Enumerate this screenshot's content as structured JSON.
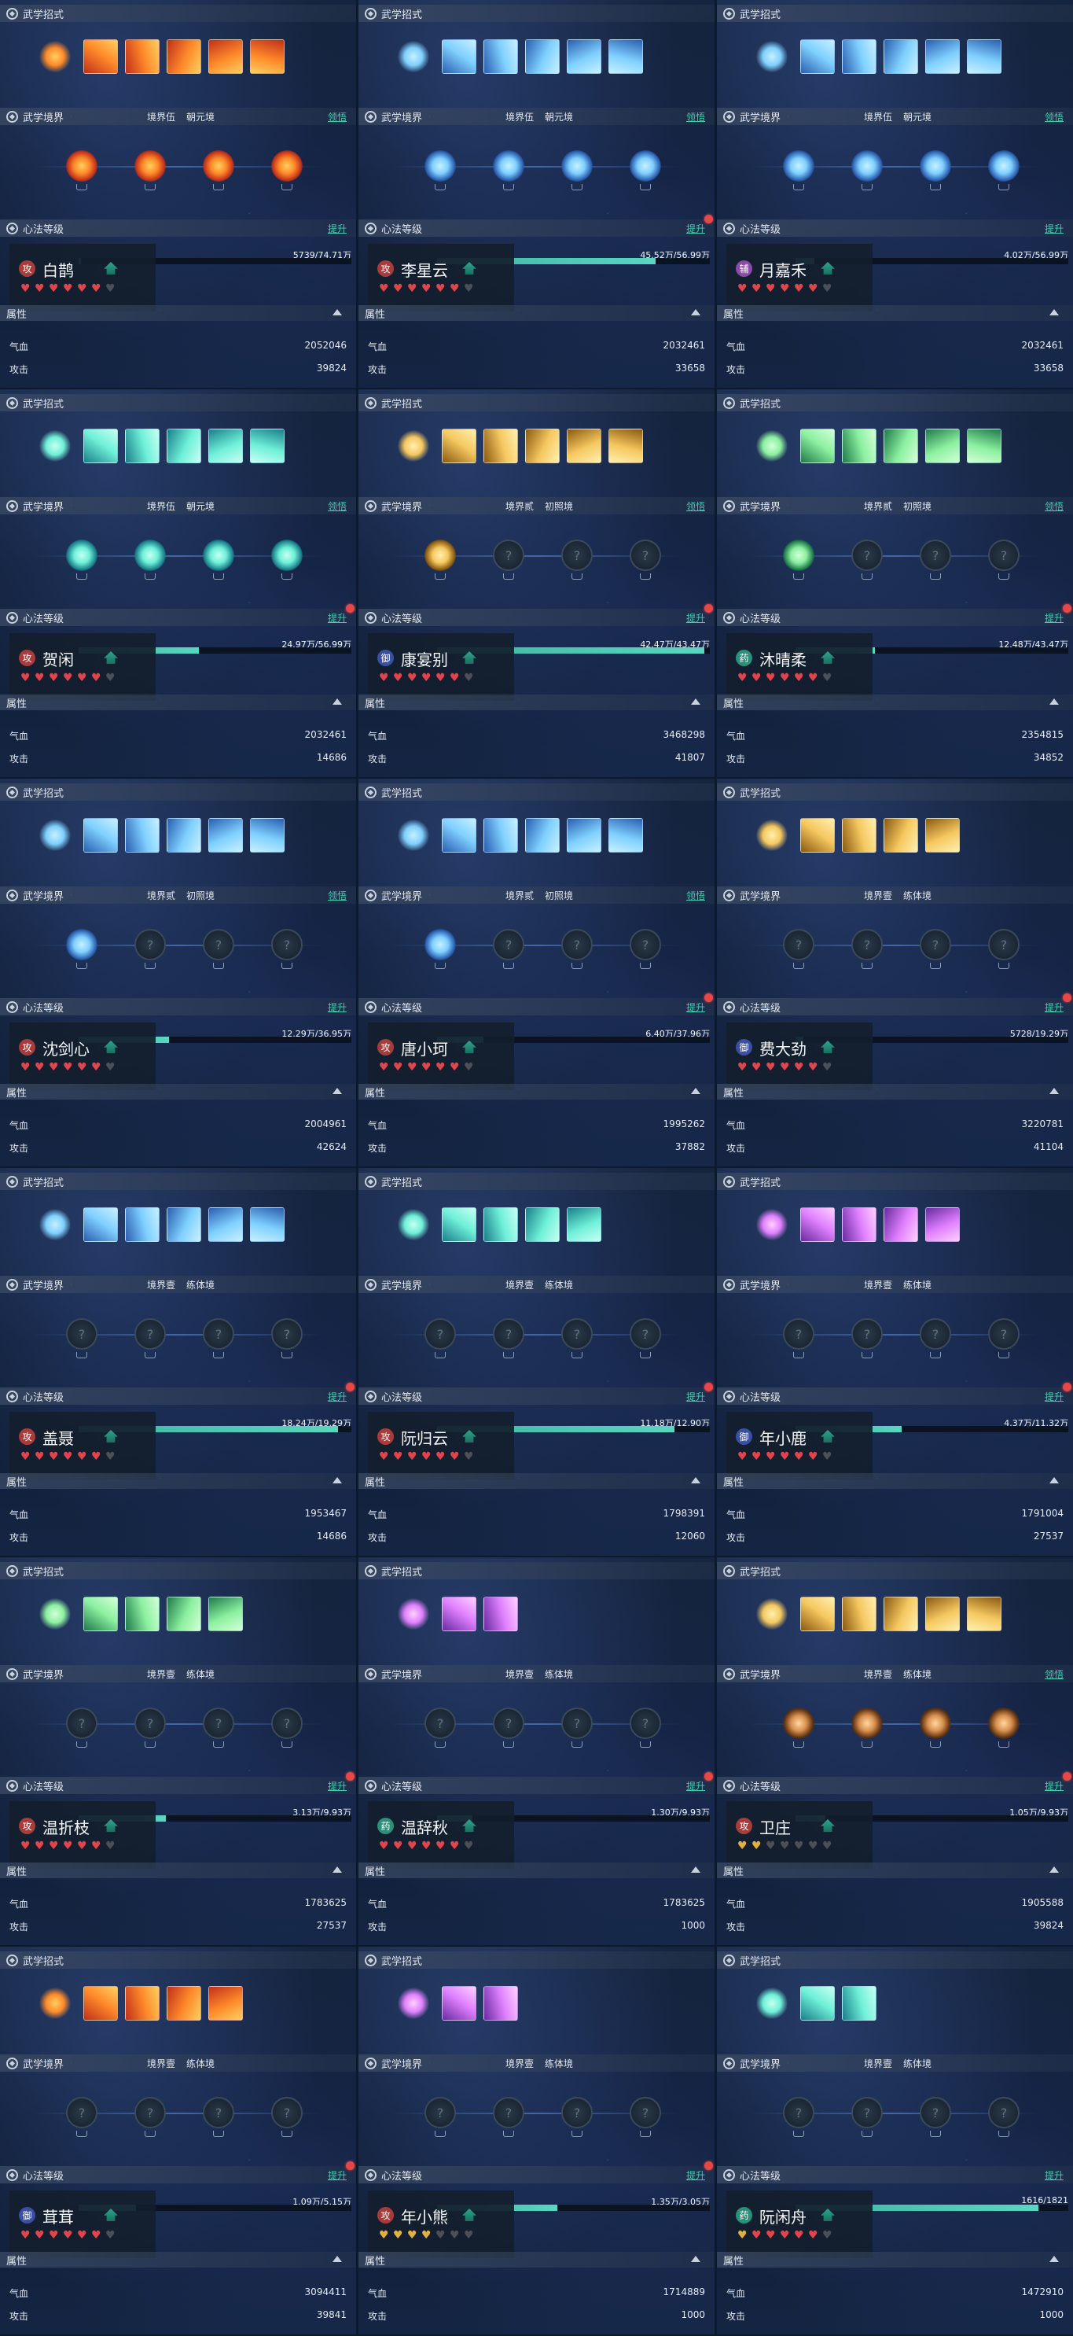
{
  "labels": {
    "skills": "武学招式",
    "realm": "武学境界",
    "heart": "心法等级",
    "attr": "属性",
    "lingwu": "领悟",
    "upgrade": "提升",
    "hp": "气血",
    "atk": "攻击"
  },
  "cards": [
    {
      "name": "白鹊",
      "role": "攻",
      "role_type": "atk",
      "realm_stage": "境界伍",
      "realm_grade": "朝元境",
      "show_lingwu": true,
      "show_dot": false,
      "progress_text": "5739/74.71万",
      "progress": 0.008,
      "hp": "2052046",
      "atk": "39824",
      "hearts": "rrrrrrd",
      "skill_count": 5,
      "skill_hue": "fire",
      "nodes_lit": 4,
      "node_hue": "fire"
    },
    {
      "name": "李星云",
      "role": "攻",
      "role_type": "atk",
      "realm_stage": "境界伍",
      "realm_grade": "朝元境",
      "show_lingwu": true,
      "show_dot": true,
      "progress_text": "45.52万/56.99万",
      "progress": 0.8,
      "hp": "2032461",
      "atk": "33658",
      "hearts": "rrrrrrd",
      "skill_count": 5,
      "skill_hue": "ice",
      "nodes_lit": 4,
      "node_hue": "ice"
    },
    {
      "name": "月嘉禾",
      "role": "辅",
      "role_type": "sup2",
      "realm_stage": "境界伍",
      "realm_grade": "朝元境",
      "show_lingwu": true,
      "show_dot": false,
      "progress_text": "4.02万/56.99万",
      "progress": 0.07,
      "hp": "2032461",
      "atk": "33658",
      "hearts": "rrrrrrd",
      "skill_count": 5,
      "skill_hue": "ice",
      "nodes_lit": 4,
      "node_hue": "ice"
    },
    {
      "name": "贺闲",
      "role": "攻",
      "role_type": "atk",
      "realm_stage": "境界伍",
      "realm_grade": "朝元境",
      "show_lingwu": true,
      "show_dot": true,
      "progress_text": "24.97万/56.99万",
      "progress": 0.44,
      "hp": "2032461",
      "atk": "14686",
      "hearts": "rrrrrrd",
      "skill_count": 5,
      "skill_hue": "teal",
      "nodes_lit": 4,
      "node_hue": "teal"
    },
    {
      "name": "康宴别",
      "role": "御",
      "role_type": "def",
      "realm_stage": "境界贰",
      "realm_grade": "初照境",
      "show_lingwu": true,
      "show_dot": true,
      "progress_text": "42.47万/43.47万",
      "progress": 0.98,
      "hp": "3468298",
      "atk": "41807",
      "hearts": "rrrrrrd",
      "skill_count": 5,
      "skill_hue": "gold",
      "nodes_lit": 1,
      "node_hue": "gold"
    },
    {
      "name": "沐晴柔",
      "role": "药",
      "role_type": "sup",
      "realm_stage": "境界贰",
      "realm_grade": "初照境",
      "show_lingwu": true,
      "show_dot": true,
      "progress_text": "12.48万/43.47万",
      "progress": 0.29,
      "hp": "2354815",
      "atk": "34852",
      "hearts": "rrrrrrd",
      "skill_count": 5,
      "skill_hue": "green",
      "nodes_lit": 1,
      "node_hue": "green"
    },
    {
      "name": "沈剑心",
      "role": "攻",
      "role_type": "atk",
      "realm_stage": "境界贰",
      "realm_grade": "初照境",
      "show_lingwu": true,
      "show_dot": false,
      "progress_text": "12.29万/36.95万",
      "progress": 0.33,
      "hp": "2004961",
      "atk": "42624",
      "hearts": "rrrrrrd",
      "skill_count": 5,
      "skill_hue": "ice",
      "nodes_lit": 1,
      "node_hue": "ice"
    },
    {
      "name": "唐小珂",
      "role": "攻",
      "role_type": "atk",
      "realm_stage": "境界贰",
      "realm_grade": "初照境",
      "show_lingwu": true,
      "show_dot": true,
      "progress_text": "6.40万/37.96万",
      "progress": 0.17,
      "hp": "1995262",
      "atk": "37882",
      "hearts": "rrrrrrd",
      "skill_count": 5,
      "skill_hue": "ice",
      "nodes_lit": 1,
      "node_hue": "ice"
    },
    {
      "name": "费大劲",
      "role": "御",
      "role_type": "def",
      "realm_stage": "境界壹",
      "realm_grade": "练体境",
      "show_lingwu": false,
      "show_dot": true,
      "progress_text": "5728/19.29万",
      "progress": 0.03,
      "hp": "3220781",
      "atk": "41104",
      "hearts": "rrrrrrd",
      "skill_count": 4,
      "skill_hue": "gold",
      "nodes_lit": 0,
      "node_hue": "gold"
    },
    {
      "name": "盖聂",
      "role": "攻",
      "role_type": "atk",
      "realm_stage": "境界壹",
      "realm_grade": "练体境",
      "show_lingwu": false,
      "show_dot": true,
      "progress_text": "18.24万/19.29万",
      "progress": 0.95,
      "hp": "1953467",
      "atk": "14686",
      "hearts": "rrrrrrd",
      "skill_count": 5,
      "skill_hue": "ice",
      "nodes_lit": 0,
      "node_hue": "ice"
    },
    {
      "name": "阮归云",
      "role": "攻",
      "role_type": "atk",
      "realm_stage": "境界壹",
      "realm_grade": "练体境",
      "show_lingwu": false,
      "show_dot": true,
      "progress_text": "11.18万/12.90万",
      "progress": 0.87,
      "hp": "1798391",
      "atk": "12060",
      "hearts": "rrrrrrd",
      "skill_count": 4,
      "skill_hue": "teal",
      "nodes_lit": 0,
      "node_hue": "teal"
    },
    {
      "name": "年小鹿",
      "role": "御",
      "role_type": "def",
      "realm_stage": "境界壹",
      "realm_grade": "练体境",
      "show_lingwu": false,
      "show_dot": true,
      "progress_text": "4.37万/11.32万",
      "progress": 0.39,
      "hp": "1791004",
      "atk": "27537",
      "hearts": "rrrrrrd",
      "skill_count": 4,
      "skill_hue": "purple",
      "nodes_lit": 0,
      "node_hue": "purple"
    },
    {
      "name": "温折枝",
      "role": "攻",
      "role_type": "atk",
      "realm_stage": "境界壹",
      "realm_grade": "练体境",
      "show_lingwu": false,
      "show_dot": true,
      "progress_text": "3.13万/9.93万",
      "progress": 0.32,
      "hp": "1783625",
      "atk": "27537",
      "hearts": "rrrrrrd",
      "skill_count": 4,
      "skill_hue": "green",
      "nodes_lit": 0,
      "node_hue": "green"
    },
    {
      "name": "温辞秋",
      "role": "药",
      "role_type": "sup",
      "realm_stage": "境界壹",
      "realm_grade": "练体境",
      "show_lingwu": false,
      "show_dot": true,
      "progress_text": "1.30万/9.93万",
      "progress": 0.13,
      "hp": "1783625",
      "atk": "1000",
      "hearts": "rrrrrrd",
      "skill_count": 2,
      "skill_hue": "purple",
      "nodes_lit": 0,
      "node_hue": "purple"
    },
    {
      "name": "卫庄",
      "role": "攻",
      "role_type": "atk",
      "realm_stage": "境界壹",
      "realm_grade": "练体境",
      "show_lingwu": true,
      "show_dot": true,
      "progress_text": "1.05万/9.93万",
      "progress": 0.11,
      "hp": "1905588",
      "atk": "39824",
      "hearts": "ggddddd",
      "skill_count": 5,
      "skill_hue": "gold",
      "nodes_lit": 4,
      "node_hue": "bronze"
    },
    {
      "name": "茸茸",
      "role": "御",
      "role_type": "def",
      "realm_stage": "境界壹",
      "realm_grade": "练体境",
      "show_lingwu": false,
      "show_dot": true,
      "progress_text": "1.09万/5.15万",
      "progress": 0.21,
      "hp": "3094411",
      "atk": "39841",
      "hearts": "rrrrrrd",
      "skill_count": 4,
      "skill_hue": "fire",
      "nodes_lit": 0,
      "node_hue": "fire"
    },
    {
      "name": "年小熊",
      "role": "攻",
      "role_type": "atk",
      "realm_stage": "境界壹",
      "realm_grade": "练体境",
      "show_lingwu": false,
      "show_dot": true,
      "progress_text": "1.35万/3.05万",
      "progress": 0.44,
      "hp": "1714889",
      "atk": "1000",
      "hearts": "ggggddd",
      "skill_count": 2,
      "skill_hue": "purple",
      "nodes_lit": 0,
      "node_hue": "purple"
    },
    {
      "name": "阮闲舟",
      "role": "药",
      "role_type": "sup",
      "realm_stage": "境界壹",
      "realm_grade": "练体境",
      "show_lingwu": false,
      "show_dot": false,
      "progress_text": "1616/1821",
      "progress": 0.89,
      "hp": "1472910",
      "atk": "1000",
      "hearts": "grrrrrd",
      "skill_count": 2,
      "skill_hue": "teal",
      "nodes_lit": 0,
      "node_hue": "teal"
    }
  ]
}
